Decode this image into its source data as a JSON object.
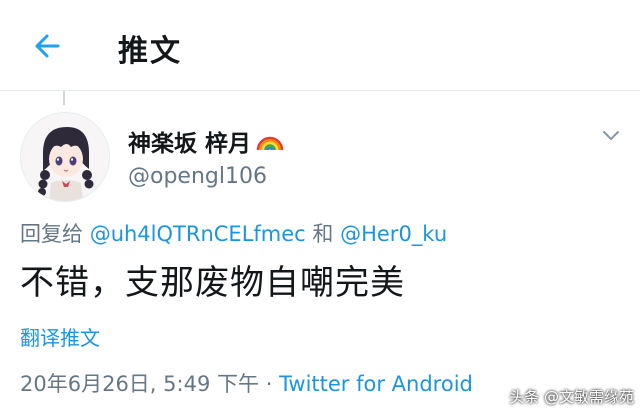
{
  "header": {
    "title": "推文",
    "back_icon": "arrow-left-icon",
    "accent_color": "#1da1f2"
  },
  "tweet": {
    "display_name": "神楽坂 梓月",
    "name_emoji": "rainbow-icon",
    "handle": "@opengl106",
    "reply_prefix": "回复给",
    "reply_to_1": "@uh4lQTRnCELfmec",
    "reply_conjunction": "和",
    "reply_to_2": "@Her0_ku",
    "text": "不错，支那废物自嘲完美",
    "translate_label": "翻译推文",
    "timestamp": "20年6月26日, 5:49 下午",
    "separator": "·",
    "source": "Twitter for Android",
    "more_icon": "chevron-down-icon",
    "link_color": "#1b95e0"
  },
  "watermark": {
    "text": "头条 @文敏需缘苑"
  }
}
